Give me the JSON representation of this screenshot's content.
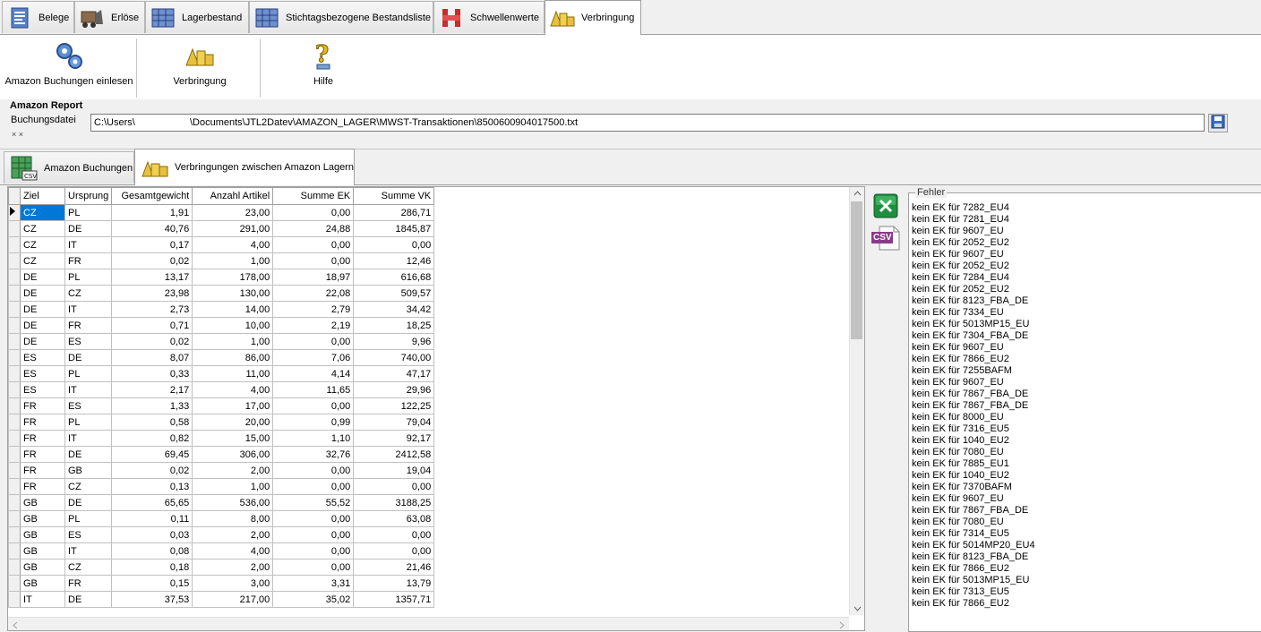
{
  "top_tabs": [
    {
      "label": "Belege",
      "icon": "receipt-icon"
    },
    {
      "label": "Erlöse",
      "icon": "forklift-icon"
    },
    {
      "label": "Lagerbestand",
      "icon": "warehouse-shelves-icon"
    },
    {
      "label": "Stichtagsbezogene Bestandsliste",
      "icon": "warehouse-shelves-icon"
    },
    {
      "label": "Schwellenwerte",
      "icon": "threshold-bar-icon"
    },
    {
      "label": "Verbringung",
      "icon": "boxes-transfer-icon"
    }
  ],
  "toolbar": {
    "import_label": "Amazon Buchungen einlesen",
    "transfer_label": "Verbringung",
    "help_label": "Hilfe"
  },
  "report": {
    "title": "Amazon Report",
    "file_label": "Buchungsdatei",
    "file_path": "C:\\Users\\                    \\Documents\\JTL2Datev\\AMAZON_LAGER\\MWST-Transaktionen\\8500600904017500.txt",
    "dots": "× ×"
  },
  "sub_tabs": [
    {
      "label": "Amazon Buchungen"
    },
    {
      "label": "Verbringungen zwischen Amazon Lagern"
    }
  ],
  "grid": {
    "columns": [
      "Ziel",
      "Ursprung",
      "Gesamtgewicht",
      "Anzahl Artikel",
      "Summe EK",
      "Summe VK"
    ],
    "rows": [
      [
        "CZ",
        "PL",
        "1,91",
        "23,00",
        "0,00",
        "286,71"
      ],
      [
        "CZ",
        "DE",
        "40,76",
        "291,00",
        "24,88",
        "1845,87"
      ],
      [
        "CZ",
        "IT",
        "0,17",
        "4,00",
        "0,00",
        "0,00"
      ],
      [
        "CZ",
        "FR",
        "0,02",
        "1,00",
        "0,00",
        "12,46"
      ],
      [
        "DE",
        "PL",
        "13,17",
        "178,00",
        "18,97",
        "616,68"
      ],
      [
        "DE",
        "CZ",
        "23,98",
        "130,00",
        "22,08",
        "509,57"
      ],
      [
        "DE",
        "IT",
        "2,73",
        "14,00",
        "2,79",
        "34,42"
      ],
      [
        "DE",
        "FR",
        "0,71",
        "10,00",
        "2,19",
        "18,25"
      ],
      [
        "DE",
        "ES",
        "0,02",
        "1,00",
        "0,00",
        "9,96"
      ],
      [
        "ES",
        "DE",
        "8,07",
        "86,00",
        "7,06",
        "740,00"
      ],
      [
        "ES",
        "PL",
        "0,33",
        "11,00",
        "4,14",
        "47,17"
      ],
      [
        "ES",
        "IT",
        "2,17",
        "4,00",
        "11,65",
        "29,96"
      ],
      [
        "FR",
        "ES",
        "1,33",
        "17,00",
        "0,00",
        "122,25"
      ],
      [
        "FR",
        "PL",
        "0,58",
        "20,00",
        "0,99",
        "79,04"
      ],
      [
        "FR",
        "IT",
        "0,82",
        "15,00",
        "1,10",
        "92,17"
      ],
      [
        "FR",
        "DE",
        "69,45",
        "306,00",
        "32,76",
        "2412,58"
      ],
      [
        "FR",
        "GB",
        "0,02",
        "2,00",
        "0,00",
        "19,04"
      ],
      [
        "FR",
        "CZ",
        "0,13",
        "1,00",
        "0,00",
        "0,00"
      ],
      [
        "GB",
        "DE",
        "65,65",
        "536,00",
        "55,52",
        "3188,25"
      ],
      [
        "GB",
        "PL",
        "0,11",
        "8,00",
        "0,00",
        "63,08"
      ],
      [
        "GB",
        "ES",
        "0,03",
        "2,00",
        "0,00",
        "0,00"
      ],
      [
        "GB",
        "IT",
        "0,08",
        "4,00",
        "0,00",
        "0,00"
      ],
      [
        "GB",
        "CZ",
        "0,18",
        "2,00",
        "0,00",
        "21,46"
      ],
      [
        "GB",
        "FR",
        "0,15",
        "3,00",
        "3,31",
        "13,79"
      ],
      [
        "IT",
        "DE",
        "37,53",
        "217,00",
        "35,02",
        "1357,71"
      ]
    ]
  },
  "export": {
    "excel_icon": "excel-icon",
    "csv_icon": "csv-file-icon",
    "csv_text": "CSV"
  },
  "errors": {
    "label": "Fehler",
    "items": [
      "kein EK für 7282_EU4",
      "kein EK für 7281_EU4",
      "kein EK für 9607_EU",
      "kein EK für 2052_EU2",
      "kein EK für 9607_EU",
      "kein EK für 2052_EU2",
      "kein EK für 7284_EU4",
      "kein EK für 2052_EU2",
      "kein EK für 8123_FBA_DE",
      "kein EK für 7334_EU",
      "kein EK für 5013MP15_EU",
      "kein EK für 7304_FBA_DE",
      "kein EK für 9607_EU",
      "kein EK für 7866_EU2",
      "kein EK für 7255BAFM",
      "kein EK für 9607_EU",
      "kein EK für 7867_FBA_DE",
      "kein EK für 7867_FBA_DE",
      "kein EK für 8000_EU",
      "kein EK für 7316_EU5",
      "kein EK für 1040_EU2",
      "kein EK für 7080_EU",
      "kein EK für 7885_EU1",
      "kein EK für 1040_EU2",
      "kein EK für 7370BAFM",
      "kein EK für 9607_EU",
      "kein EK für 7867_FBA_DE",
      "kein EK für 7080_EU",
      "kein EK für 7314_EU5",
      "kein EK für 5014MP20_EU4",
      "kein EK für 8123_FBA_DE",
      "kein EK für 7866_EU2",
      "kein EK für 5013MP15_EU",
      "kein EK für 7313_EU5",
      "kein EK für 7866_EU2"
    ]
  }
}
